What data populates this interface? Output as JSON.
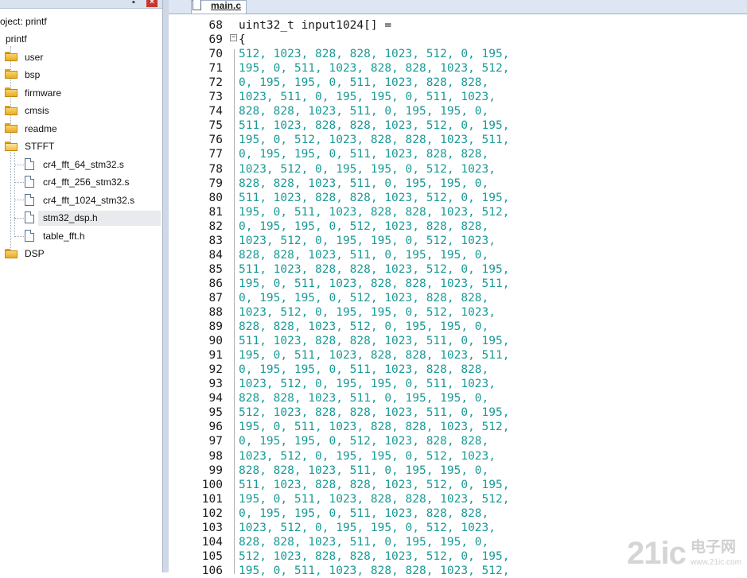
{
  "sidebar": {
    "project_label": "oject: printf",
    "root_label": "printf",
    "folders": [
      "user",
      "bsp",
      "firmware",
      "cmsis",
      "readme"
    ],
    "stfft_label": "STFFT",
    "files": [
      "cr4_fft_64_stm32.s",
      "cr4_fft_256_stm32.s",
      "cr4_fft_1024_stm32.s",
      "stm32_dsp.h",
      "table_fft.h"
    ],
    "dsp_label": "DSP"
  },
  "editor": {
    "tab_label": "main.c",
    "lines": [
      {
        "n": "68",
        "t": "uint32_t input1024[] ="
      },
      {
        "n": "69",
        "t": "{"
      },
      {
        "n": "70",
        "t": "512, 1023, 828, 828, 1023, 512, 0, 195,"
      },
      {
        "n": "71",
        "t": "195, 0, 511, 1023, 828, 828, 1023, 512,"
      },
      {
        "n": "72",
        "t": "0, 195, 195, 0, 511, 1023, 828, 828,"
      },
      {
        "n": "73",
        "t": "1023, 511, 0, 195, 195, 0, 511, 1023,"
      },
      {
        "n": "74",
        "t": "828, 828, 1023, 511, 0, 195, 195, 0,"
      },
      {
        "n": "75",
        "t": "511, 1023, 828, 828, 1023, 512, 0, 195,"
      },
      {
        "n": "76",
        "t": "195, 0, 512, 1023, 828, 828, 1023, 511,"
      },
      {
        "n": "77",
        "t": "0, 195, 195, 0, 511, 1023, 828, 828,"
      },
      {
        "n": "78",
        "t": "1023, 512, 0, 195, 195, 0, 512, 1023,"
      },
      {
        "n": "79",
        "t": "828, 828, 1023, 511, 0, 195, 195, 0,"
      },
      {
        "n": "80",
        "t": "511, 1023, 828, 828, 1023, 512, 0, 195,"
      },
      {
        "n": "81",
        "t": "195, 0, 511, 1023, 828, 828, 1023, 512,"
      },
      {
        "n": "82",
        "t": "0, 195, 195, 0, 512, 1023, 828, 828,"
      },
      {
        "n": "83",
        "t": "1023, 512, 0, 195, 195, 0, 512, 1023,"
      },
      {
        "n": "84",
        "t": "828, 828, 1023, 511, 0, 195, 195, 0,"
      },
      {
        "n": "85",
        "t": "511, 1023, 828, 828, 1023, 512, 0, 195,"
      },
      {
        "n": "86",
        "t": "195, 0, 511, 1023, 828, 828, 1023, 511,"
      },
      {
        "n": "87",
        "t": "0, 195, 195, 0, 512, 1023, 828, 828,"
      },
      {
        "n": "88",
        "t": "1023, 512, 0, 195, 195, 0, 512, 1023,"
      },
      {
        "n": "89",
        "t": "828, 828, 1023, 512, 0, 195, 195, 0,"
      },
      {
        "n": "90",
        "t": "511, 1023, 828, 828, 1023, 511, 0, 195,"
      },
      {
        "n": "91",
        "t": "195, 0, 511, 1023, 828, 828, 1023, 511,"
      },
      {
        "n": "92",
        "t": "0, 195, 195, 0, 511, 1023, 828, 828,"
      },
      {
        "n": "93",
        "t": "1023, 512, 0, 195, 195, 0, 511, 1023,"
      },
      {
        "n": "94",
        "t": "828, 828, 1023, 511, 0, 195, 195, 0,"
      },
      {
        "n": "95",
        "t": "512, 1023, 828, 828, 1023, 511, 0, 195,"
      },
      {
        "n": "96",
        "t": "195, 0, 511, 1023, 828, 828, 1023, 512,"
      },
      {
        "n": "97",
        "t": "0, 195, 195, 0, 512, 1023, 828, 828,"
      },
      {
        "n": "98",
        "t": "1023, 512, 0, 195, 195, 0, 512, 1023,"
      },
      {
        "n": "99",
        "t": "828, 828, 1023, 511, 0, 195, 195, 0,"
      },
      {
        "n": "100",
        "t": "511, 1023, 828, 828, 1023, 512, 0, 195,"
      },
      {
        "n": "101",
        "t": "195, 0, 511, 1023, 828, 828, 1023, 512,"
      },
      {
        "n": "102",
        "t": "0, 195, 195, 0, 511, 1023, 828, 828,"
      },
      {
        "n": "103",
        "t": "1023, 512, 0, 195, 195, 0, 512, 1023,"
      },
      {
        "n": "104",
        "t": "828, 828, 1023, 511, 0, 195, 195, 0,"
      },
      {
        "n": "105",
        "t": "512, 1023, 828, 828, 1023, 512, 0, 195,"
      },
      {
        "n": "106",
        "t": "195, 0, 511, 1023, 828, 828, 1023, 512,"
      }
    ]
  },
  "watermark": {
    "brand": "21ic",
    "cn": "电子网",
    "url": "www.21ic.com"
  },
  "colors": {
    "number": "#1a9a96",
    "folder": "#f0bf45"
  },
  "icons": [
    "pin-icon",
    "close-icon",
    "folder-icon",
    "file-icon",
    "fold-collapse-icon"
  ]
}
